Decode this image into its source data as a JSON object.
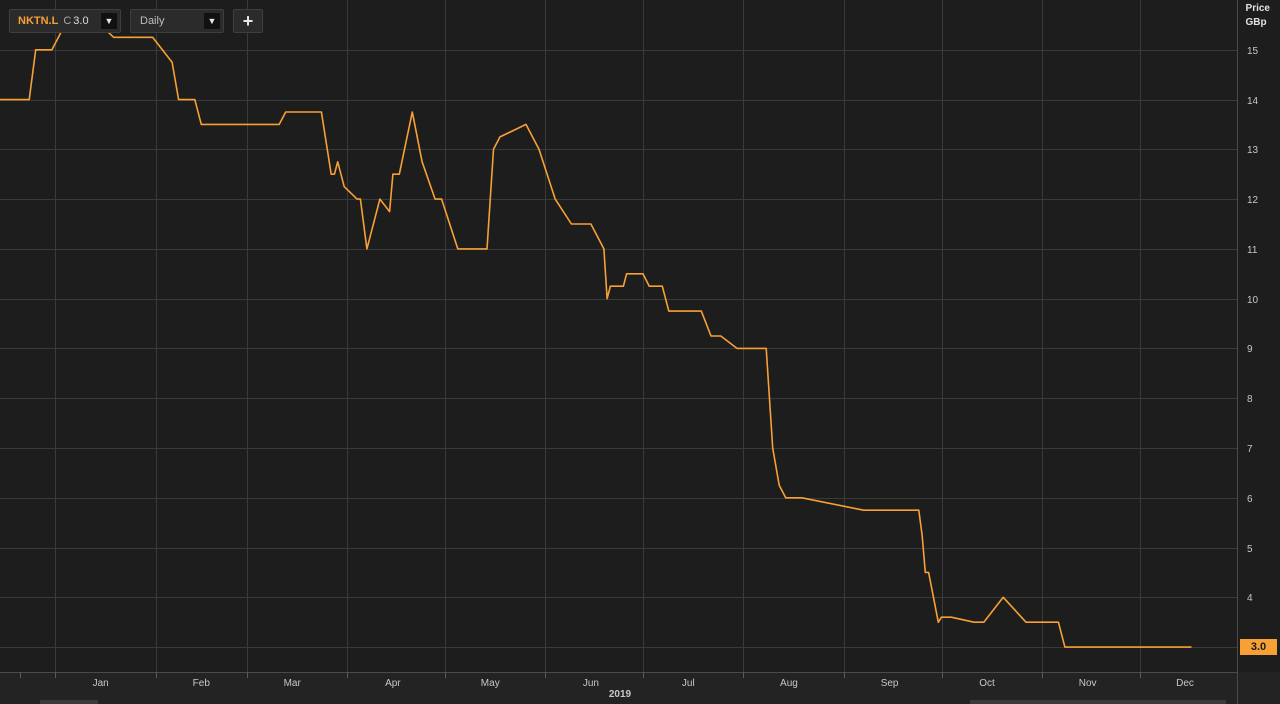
{
  "toolbar": {
    "instrument": "NKTN.L",
    "series_type": "C",
    "series_value": "3.0",
    "period": "Daily",
    "add_label": "+"
  },
  "axis_header": {
    "line1": "Price",
    "line2": "GBp"
  },
  "last_price_label": "3.0",
  "colors": {
    "line": "#f7a035",
    "background": "#1d1d1d",
    "grid": "#3a3a3a"
  },
  "chart_data": {
    "type": "line",
    "title": "",
    "xlabel": "2019",
    "ylabel": "Price GBp",
    "ylim": [
      2.5,
      16
    ],
    "yticks": [
      3,
      4,
      5,
      6,
      7,
      8,
      9,
      10,
      11,
      12,
      13,
      14,
      15
    ],
    "xlim": [
      "2018-12-15",
      "2019-12-31"
    ],
    "month_ticks": [
      {
        "label": "Jan",
        "date": "2019-01-15"
      },
      {
        "label": "Feb",
        "date": "2019-02-15"
      },
      {
        "label": "Mar",
        "date": "2019-03-15"
      },
      {
        "label": "Apr",
        "date": "2019-04-15"
      },
      {
        "label": "May",
        "date": "2019-05-15"
      },
      {
        "label": "Jun",
        "date": "2019-06-15"
      },
      {
        "label": "Jul",
        "date": "2019-07-15"
      },
      {
        "label": "Aug",
        "date": "2019-08-15"
      },
      {
        "label": "Sep",
        "date": "2019-09-15"
      },
      {
        "label": "Oct",
        "date": "2019-10-15"
      },
      {
        "label": "Nov",
        "date": "2019-11-15"
      },
      {
        "label": "Dec",
        "date": "2019-12-15"
      }
    ],
    "series": [
      {
        "name": "NKTN.L",
        "x": [
          "2018-12-15",
          "2018-12-24",
          "2018-12-26",
          "2018-12-31",
          "2019-01-04",
          "2019-01-15",
          "2019-01-19",
          "2019-01-31",
          "2019-02-06",
          "2019-02-08",
          "2019-02-13",
          "2019-02-15",
          "2019-02-21",
          "2019-03-11",
          "2019-03-13",
          "2019-03-24",
          "2019-03-27",
          "2019-03-28",
          "2019-03-29",
          "2019-03-31",
          "2019-04-04",
          "2019-04-05",
          "2019-04-07",
          "2019-04-11",
          "2019-04-14",
          "2019-04-15",
          "2019-04-17",
          "2019-04-21",
          "2019-04-24",
          "2019-04-28",
          "2019-04-30",
          "2019-05-05",
          "2019-05-08",
          "2019-05-14",
          "2019-05-16",
          "2019-05-18",
          "2019-05-26",
          "2019-05-30",
          "2019-06-04",
          "2019-06-09",
          "2019-06-15",
          "2019-06-19",
          "2019-06-20",
          "2019-06-21",
          "2019-06-25",
          "2019-06-26",
          "2019-06-29",
          "2019-07-01",
          "2019-07-03",
          "2019-07-07",
          "2019-07-09",
          "2019-07-19",
          "2019-07-22",
          "2019-07-25",
          "2019-07-30",
          "2019-08-01",
          "2019-08-08",
          "2019-08-10",
          "2019-08-12",
          "2019-08-14",
          "2019-08-19",
          "2019-09-07",
          "2019-09-15",
          "2019-09-24",
          "2019-09-25",
          "2019-09-26",
          "2019-09-27",
          "2019-09-30",
          "2019-10-01",
          "2019-10-04",
          "2019-10-11",
          "2019-10-14",
          "2019-10-20",
          "2019-10-27",
          "2019-10-29",
          "2019-11-06",
          "2019-11-08",
          "2019-11-11",
          "2019-11-18",
          "2019-11-19",
          "2019-11-26",
          "2019-11-28",
          "2019-11-29",
          "2019-12-09",
          "2019-12-10",
          "2019-12-11",
          "2019-12-14",
          "2019-12-16",
          "2019-12-17"
        ],
        "y": [
          14.0,
          14.0,
          15.0,
          15.0,
          15.5,
          15.5,
          15.25,
          15.25,
          14.75,
          14.0,
          14.0,
          13.5,
          13.5,
          13.5,
          13.75,
          13.75,
          12.5,
          12.5,
          12.75,
          12.25,
          12.0,
          12.0,
          11.0,
          12.0,
          11.75,
          12.5,
          12.5,
          13.75,
          12.75,
          12.0,
          12.0,
          11.0,
          11.0,
          11.0,
          13.0,
          13.25,
          13.5,
          13.0,
          12.0,
          11.5,
          11.5,
          11.0,
          10.0,
          10.25,
          10.25,
          10.5,
          10.5,
          10.5,
          10.25,
          10.25,
          9.75,
          9.75,
          9.25,
          9.25,
          9.0,
          9.0,
          9.0,
          7.0,
          6.25,
          6.0,
          6.0,
          5.75,
          5.75,
          5.75,
          5.25,
          4.5,
          4.5,
          3.5,
          3.6,
          3.6,
          3.5,
          3.5,
          4.0,
          3.5,
          3.5,
          3.5,
          3.0,
          3.0,
          3.0,
          3.0,
          3.0,
          3.0,
          3.0,
          3.0,
          3.0,
          3.0,
          3.0,
          3.0,
          3.0
        ]
      }
    ]
  }
}
